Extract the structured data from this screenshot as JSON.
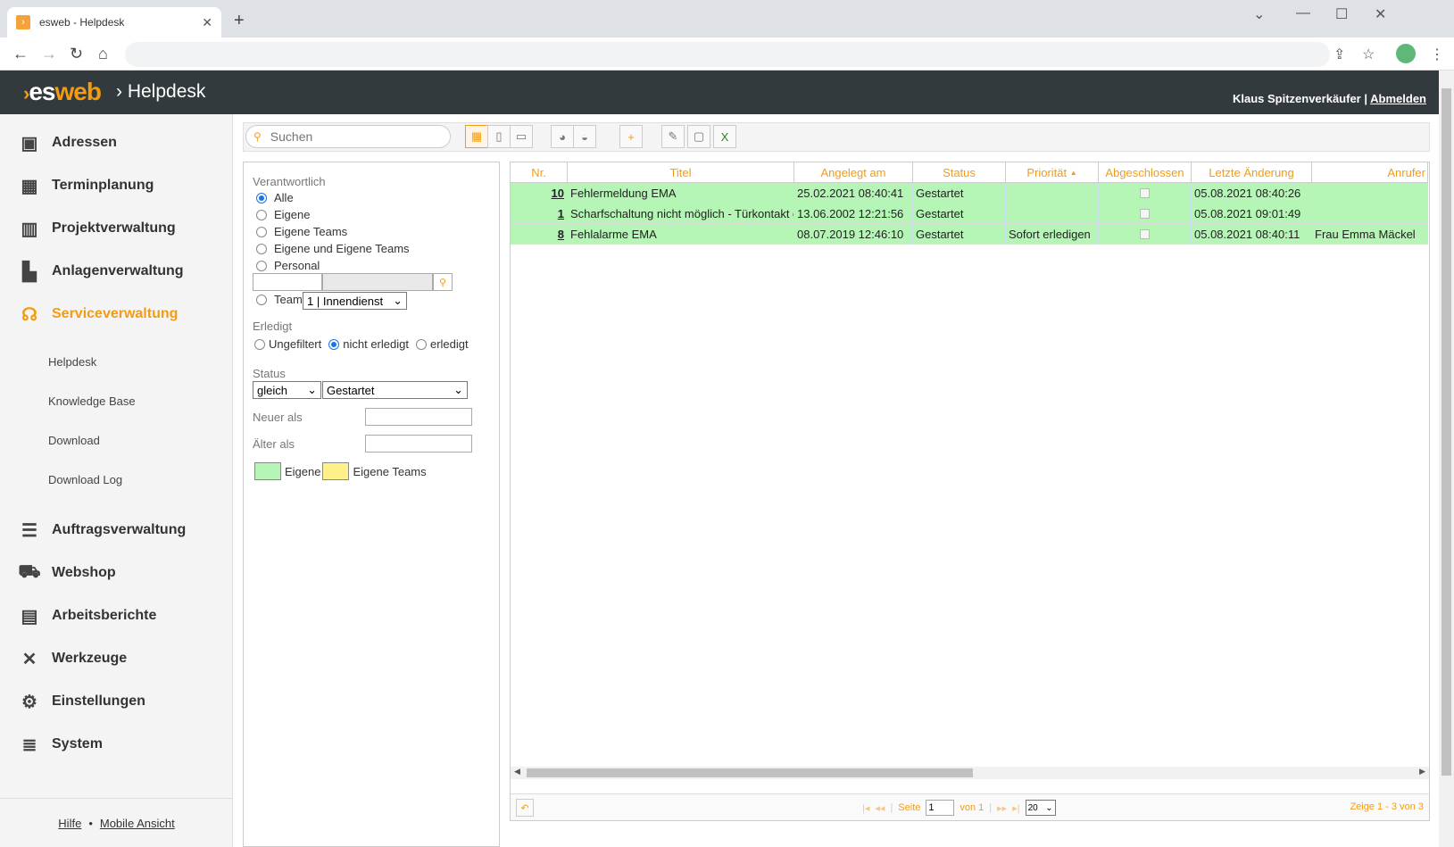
{
  "browser": {
    "tab_title": "esweb - Helpdesk",
    "tab_close": "✕",
    "new_tab": "+"
  },
  "header": {
    "logo_es": "es",
    "logo_web": "web",
    "app_title": "Helpdesk",
    "user": "Klaus Spitzenverkäufer",
    "separator": "|",
    "logout": "Abmelden"
  },
  "sidebar": {
    "items": [
      {
        "label": "Adressen",
        "icon": "address-book-icon"
      },
      {
        "label": "Terminplanung",
        "icon": "calendar-icon"
      },
      {
        "label": "Projektverwaltung",
        "icon": "project-icon"
      },
      {
        "label": "Anlagenverwaltung",
        "icon": "factory-icon"
      },
      {
        "label": "Serviceverwaltung",
        "icon": "headset-icon",
        "active": true
      },
      {
        "label": "Auftragsverwaltung",
        "icon": "list-icon"
      },
      {
        "label": "Webshop",
        "icon": "cart-icon"
      },
      {
        "label": "Arbeitsberichte",
        "icon": "clipboard-icon"
      },
      {
        "label": "Werkzeuge",
        "icon": "tools-icon"
      },
      {
        "label": "Einstellungen",
        "icon": "gears-icon"
      },
      {
        "label": "System",
        "icon": "database-icon"
      }
    ],
    "subitems": [
      "Helpdesk",
      "Knowledge Base",
      "Download",
      "Download Log"
    ],
    "footer": {
      "help": "Hilfe",
      "dot": "•",
      "mobile": "Mobile Ansicht"
    }
  },
  "toolbar": {
    "search_placeholder": "Suchen"
  },
  "filter": {
    "responsible_label": "Verantwortlich",
    "responsible_options": [
      "Alle",
      "Eigene",
      "Eigene Teams",
      "Eigene und Eigene Teams",
      "Personal"
    ],
    "team_label": "Team",
    "team_value": "1 | Innendienst",
    "done_label": "Erledigt",
    "done_options": [
      "Ungefiltert",
      "nicht erledigt",
      "erledigt"
    ],
    "status_label": "Status",
    "status_op": "gleich",
    "status_value": "Gestartet",
    "newer_label": "Neuer als",
    "older_label": "Älter als",
    "legend_own": "Eigene",
    "legend_teams": "Eigene Teams",
    "colors": {
      "own": "#b5f5b5",
      "teams": "#fff18a"
    }
  },
  "grid": {
    "columns": [
      "Nr.",
      "Titel",
      "Angelegt am",
      "Status",
      "Priorität",
      "Abgeschlossen",
      "Letzte Änderung",
      "Anrufer"
    ],
    "sort_indicator": "▲",
    "rows": [
      {
        "nr": "10",
        "titel": "Fehlermeldung EMA",
        "angelegt": "25.02.2021 08:40:41",
        "status": "Gestartet",
        "prio": "",
        "geaendert": "05.08.2021 08:40:26",
        "anrufer": ""
      },
      {
        "nr": "1",
        "titel": "Scharfschaltung nicht möglich - Türkontakt defekt",
        "angelegt": "13.06.2002 12:21:56",
        "status": "Gestartet",
        "prio": "",
        "geaendert": "05.08.2021 09:01:49",
        "anrufer": ""
      },
      {
        "nr": "8",
        "titel": "Fehlalarme EMA",
        "angelegt": "08.07.2019 12:46:10",
        "status": "Gestartet",
        "prio": "Sofort erledigen",
        "geaendert": "05.08.2021 08:40:11",
        "anrufer": "Frau Emma Mäckel"
      }
    ]
  },
  "pager": {
    "page_label": "Seite",
    "page_value": "1",
    "of_label": "von 1",
    "page_size": "20",
    "summary": "Zeige 1 - 3 von 3"
  }
}
